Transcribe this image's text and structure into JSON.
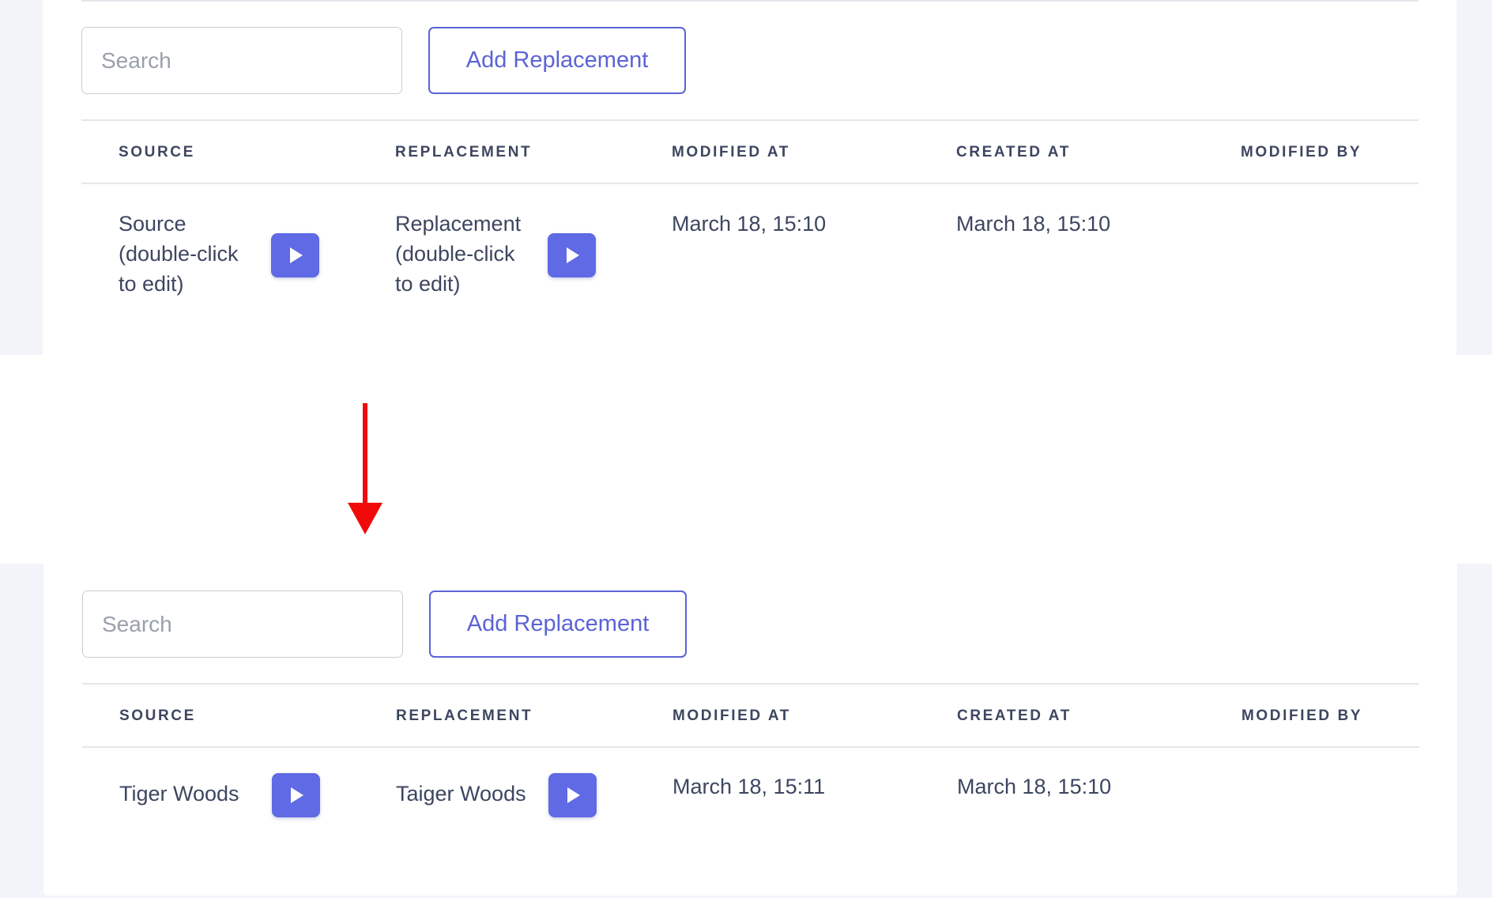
{
  "colors": {
    "accent": "#5b63d6",
    "play_button": "#5f6ae4",
    "text": "#3d4660",
    "arrow": "#f00a0a"
  },
  "icons": {
    "play": "play-icon",
    "arrow": "down-arrow"
  },
  "before": {
    "search": {
      "placeholder": "Search"
    },
    "add_button_label": "Add Replacement",
    "columns": [
      "SOURCE",
      "REPLACEMENT",
      "MODIFIED AT",
      "CREATED AT",
      "MODIFIED BY"
    ],
    "row": {
      "source": "Source (double-click to edit)",
      "replacement": "Replacement (double-click to edit)",
      "modified_at": "March 18, 15:10",
      "created_at": "March 18, 15:10",
      "modified_by": ""
    }
  },
  "after": {
    "search": {
      "placeholder": "Search"
    },
    "add_button_label": "Add Replacement",
    "columns": [
      "SOURCE",
      "REPLACEMENT",
      "MODIFIED AT",
      "CREATED AT",
      "MODIFIED BY"
    ],
    "row": {
      "source": "Tiger Woods",
      "replacement": "Taiger Woods",
      "modified_at": "March 18, 15:11",
      "created_at": "March 18, 15:10",
      "modified_by": ""
    }
  }
}
